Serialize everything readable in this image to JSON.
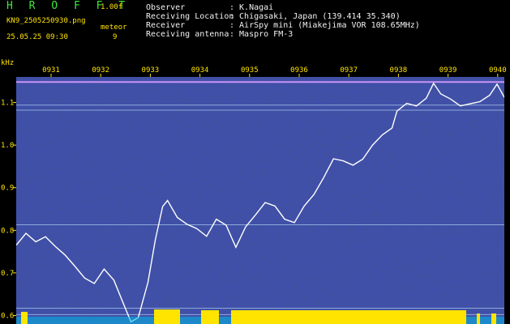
{
  "header": {
    "app_name": "H R O F F T",
    "version": "1.00f",
    "filename": "KN9_2505250930.png",
    "datetime": "25.05.25 09:30",
    "meteor_label": "meteor",
    "meteor_count": "9",
    "meta": [
      {
        "label": "Observer",
        "value": ": K.Nagai"
      },
      {
        "label": "Receiving Location",
        "value": ": Chigasaki, Japan (139.414 35.340)"
      },
      {
        "label": "Receiver",
        "value": ": AirSpy mini (Miakejima VOR 108.65MHz)"
      },
      {
        "label": "Receiving antenna",
        "value": ": Maspro FM-3"
      }
    ]
  },
  "colors": {
    "background": "#0a0a5a",
    "trace": "#ffffff",
    "header_green": "#3bea3b",
    "header_yellow": "#ffe400",
    "band_yellow": "#ffe400",
    "band_cyan": "#00e5ff"
  },
  "chart_data": {
    "type": "heatmap",
    "ylabel": "kHz",
    "ylim": [
      0.58,
      1.16
    ],
    "y_ticks": [
      0.6,
      0.7,
      0.8,
      0.9,
      1.0,
      1.1
    ],
    "y_tick_labels": [
      "0.6",
      "0.7",
      "0.8",
      "0.9",
      "1.0",
      "1.1"
    ],
    "x_ticks": [
      "0931",
      "0932",
      "0933",
      "0934",
      "0935",
      "0936",
      "0937",
      "0938",
      "0939",
      "0940"
    ],
    "carrier_lines": [
      1.148,
      1.094,
      1.082,
      0.813,
      0.617,
      0.602
    ],
    "trace": [
      [
        0.0,
        0.765
      ],
      [
        0.02,
        0.793
      ],
      [
        0.04,
        0.773
      ],
      [
        0.06,
        0.785
      ],
      [
        0.08,
        0.762
      ],
      [
        0.1,
        0.742
      ],
      [
        0.12,
        0.716
      ],
      [
        0.14,
        0.688
      ],
      [
        0.16,
        0.675
      ],
      [
        0.18,
        0.709
      ],
      [
        0.2,
        0.683
      ],
      [
        0.22,
        0.627
      ],
      [
        0.235,
        0.585
      ],
      [
        0.25,
        0.595
      ],
      [
        0.27,
        0.678
      ],
      [
        0.285,
        0.778
      ],
      [
        0.3,
        0.856
      ],
      [
        0.31,
        0.87
      ],
      [
        0.33,
        0.83
      ],
      [
        0.35,
        0.814
      ],
      [
        0.37,
        0.804
      ],
      [
        0.39,
        0.786
      ],
      [
        0.41,
        0.826
      ],
      [
        0.43,
        0.812
      ],
      [
        0.45,
        0.76
      ],
      [
        0.47,
        0.808
      ],
      [
        0.49,
        0.836
      ],
      [
        0.51,
        0.865
      ],
      [
        0.53,
        0.857
      ],
      [
        0.55,
        0.826
      ],
      [
        0.57,
        0.818
      ],
      [
        0.59,
        0.857
      ],
      [
        0.61,
        0.884
      ],
      [
        0.63,
        0.924
      ],
      [
        0.65,
        0.968
      ],
      [
        0.67,
        0.963
      ],
      [
        0.69,
        0.953
      ],
      [
        0.71,
        0.967
      ],
      [
        0.73,
        1.0
      ],
      [
        0.75,
        1.024
      ],
      [
        0.77,
        1.04
      ],
      [
        0.78,
        1.08
      ],
      [
        0.8,
        1.098
      ],
      [
        0.82,
        1.092
      ],
      [
        0.84,
        1.11
      ],
      [
        0.855,
        1.145
      ],
      [
        0.87,
        1.12
      ],
      [
        0.89,
        1.108
      ],
      [
        0.91,
        1.092
      ],
      [
        0.93,
        1.097
      ],
      [
        0.95,
        1.102
      ],
      [
        0.97,
        1.117
      ],
      [
        0.985,
        1.143
      ],
      [
        1.0,
        1.112
      ]
    ]
  }
}
